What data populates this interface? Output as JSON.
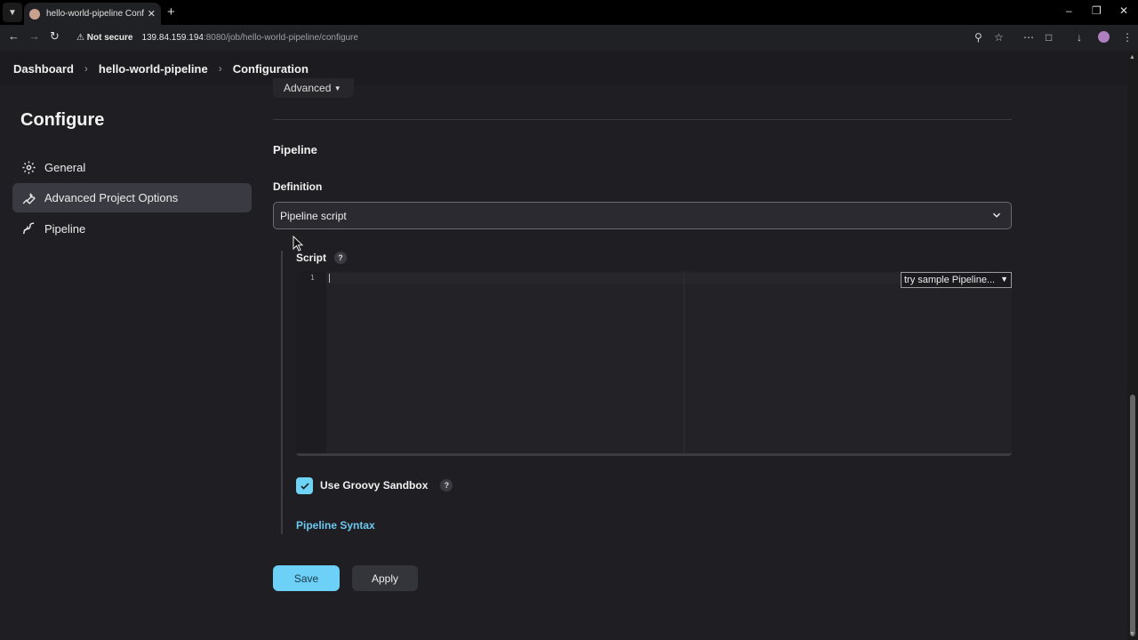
{
  "browser": {
    "tab_title": "hello-world-pipeline Config [Je",
    "not_secure": "Not secure",
    "url_host": "139.84.159.194",
    "url_rest": ":8080/job/hello-world-pipeline/configure"
  },
  "breadcrumb": {
    "items": [
      "Dashboard",
      "hello-world-pipeline",
      "Configuration"
    ]
  },
  "sidebar": {
    "title": "Configure",
    "items": [
      {
        "label": "General",
        "icon": "gear-icon"
      },
      {
        "label": "Advanced Project Options",
        "icon": "wrench-icon",
        "active": true
      },
      {
        "label": "Pipeline",
        "icon": "pipeline-icon"
      }
    ]
  },
  "main": {
    "advanced_button": "Advanced",
    "section_title": "Pipeline",
    "definition_label": "Definition",
    "definition_value": "Pipeline script",
    "script_label": "Script",
    "help_glyph": "?",
    "editor_line_number": "1",
    "sample_select": "try sample Pipeline...",
    "sandbox_label": "Use Groovy Sandbox",
    "sandbox_checked": true,
    "syntax_link": "Pipeline Syntax",
    "save_label": "Save",
    "apply_label": "Apply"
  },
  "colors": {
    "accent": "#6cd0f7",
    "link": "#6cc8ee",
    "background": "#1f1f23"
  }
}
